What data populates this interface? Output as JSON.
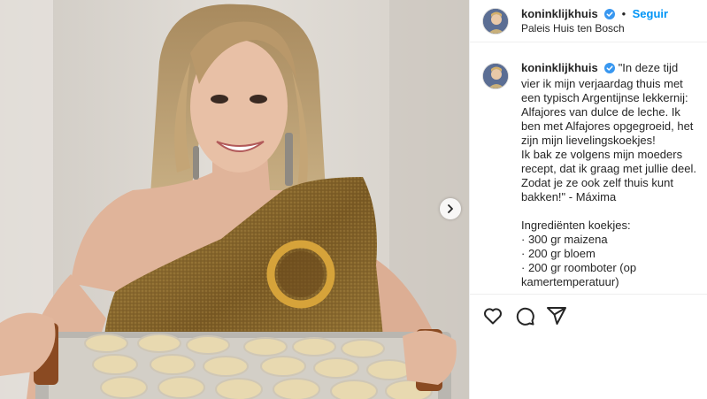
{
  "post": {
    "account": {
      "username": "koninklijkhuis",
      "verified": true,
      "follow_label": "Seguir",
      "separator": "•",
      "location": "Paleis Huis ten Bosch"
    },
    "caption": {
      "username": "koninklijkhuis",
      "text": "\"In deze tijd vier ik mijn verjaardag thuis met een typisch Argentijnse lekkernij: Alfajores van dulce de leche. Ik ben met Alfajores opgegroeid, het zijn mijn lievelingskoekjes!\nIk bak ze volgens mijn moeders recept, dat ik graag met jullie deel. Zodat je ze ook zelf thuis kunt bakken!\" - Máxima\n\nIngrediënten koekjes:\n· 300 gr maizena\n· 200 gr bloem\n· 200 gr roomboter (op kamertemperatuur)"
    },
    "icons": {
      "like": "heart-icon",
      "comment": "comment-icon",
      "share": "share-icon",
      "next": "chevron-right-icon",
      "verified": "verified-badge-icon"
    },
    "colors": {
      "accent": "#0095f6",
      "text": "#262626",
      "border": "#efefef",
      "dress": "#8a6a2e",
      "background_wall": "#d8d3cc"
    }
  }
}
